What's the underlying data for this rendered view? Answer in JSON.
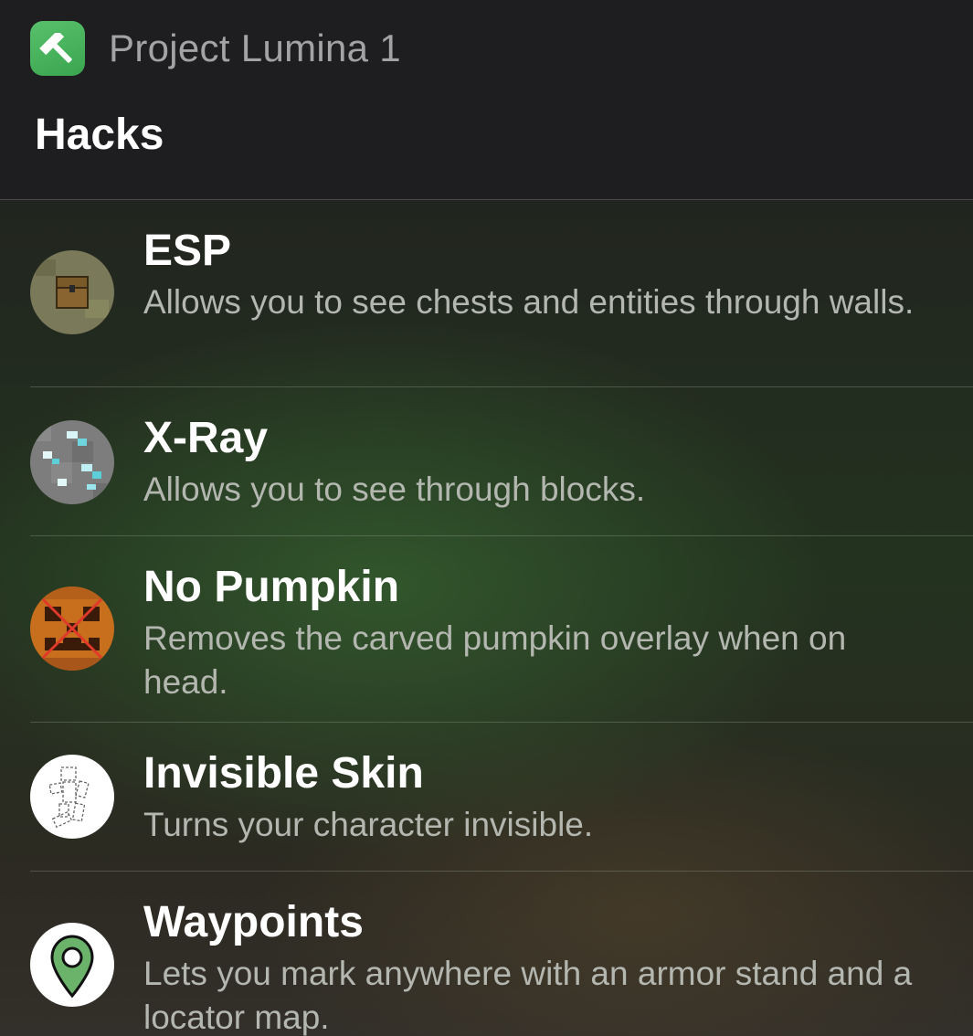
{
  "header": {
    "app_name": "Project Lumina 1",
    "app_icon": "hammer-icon",
    "section_title": "Hacks"
  },
  "items": [
    {
      "title": "ESP",
      "description": "Allows you to see chests and entities through walls.",
      "icon": "chest-icon"
    },
    {
      "title": "X-Ray",
      "description": "Allows you to see through blocks.",
      "icon": "diamond-ore-icon"
    },
    {
      "title": "No Pumpkin",
      "description": "Removes the carved pumpkin overlay when on head.",
      "icon": "pumpkin-icon"
    },
    {
      "title": "Invisible Skin",
      "description": "Turns your character invisible.",
      "icon": "invisible-skin-icon"
    },
    {
      "title": "Waypoints",
      "description": "Lets you mark anywhere with an armor stand and a locator map.",
      "icon": "map-pin-icon"
    }
  ],
  "colors": {
    "app_icon_green": "#4cb35e",
    "pin_green": "#6bb26a"
  }
}
